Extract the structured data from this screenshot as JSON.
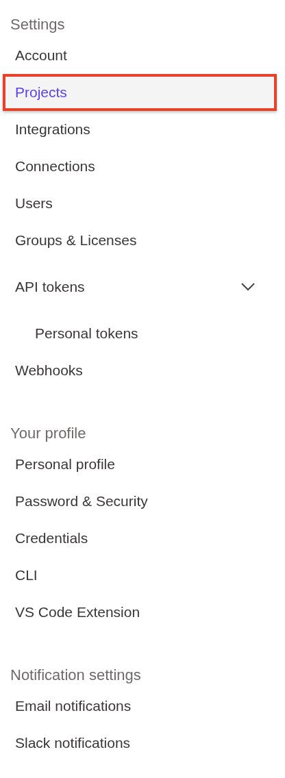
{
  "sections": [
    {
      "title": "Settings",
      "items": [
        {
          "label": "Account",
          "selected": false
        },
        {
          "label": "Projects",
          "selected": true
        },
        {
          "label": "Integrations",
          "selected": false
        },
        {
          "label": "Connections",
          "selected": false
        },
        {
          "label": "Users",
          "selected": false
        },
        {
          "label": "Groups & Licenses",
          "selected": false
        },
        {
          "label": "API tokens",
          "selected": false,
          "expanded": true,
          "children": [
            {
              "label": "Personal tokens",
              "selected": false
            }
          ]
        },
        {
          "label": "Webhooks",
          "selected": false
        }
      ]
    },
    {
      "title": "Your profile",
      "items": [
        {
          "label": "Personal profile",
          "selected": false
        },
        {
          "label": "Password & Security",
          "selected": false
        },
        {
          "label": "Credentials",
          "selected": false
        },
        {
          "label": "CLI",
          "selected": false
        },
        {
          "label": "VS Code Extension",
          "selected": false
        }
      ]
    },
    {
      "title": "Notification settings",
      "items": [
        {
          "label": "Email notifications",
          "selected": false
        },
        {
          "label": "Slack notifications",
          "selected": false
        }
      ]
    }
  ]
}
